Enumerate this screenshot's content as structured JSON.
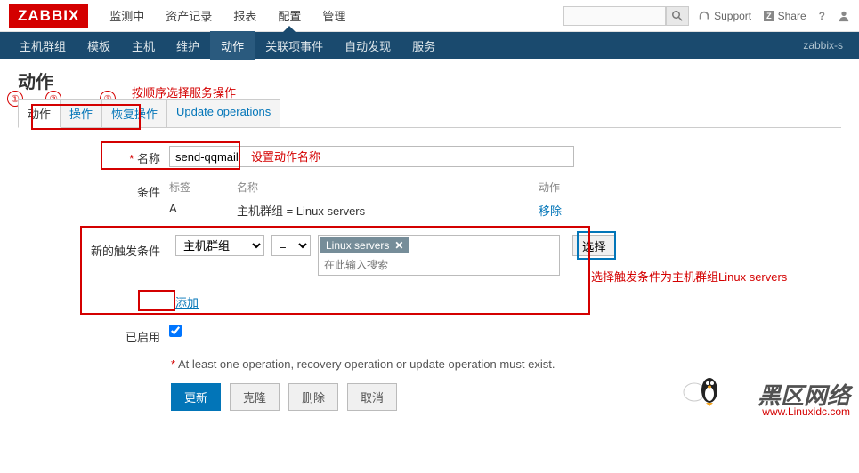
{
  "logo": "ZABBIX",
  "main_nav": [
    "监测中",
    "资产记录",
    "报表",
    "配置",
    "管理"
  ],
  "main_nav_active": 3,
  "header_links": {
    "support": "Support",
    "share": "Share"
  },
  "sub_nav": [
    "主机群组",
    "模板",
    "主机",
    "维护",
    "动作",
    "关联项事件",
    "自动发现",
    "服务"
  ],
  "sub_nav_active": 4,
  "sub_nav_right": "zabbix-s",
  "page_title": "动作",
  "tabs": [
    "动作",
    "操作",
    "恢复操作",
    "Update operations"
  ],
  "tabs_active": 0,
  "form": {
    "name_label": "名称",
    "name_value": "send-qqmail",
    "conditions_label": "条件",
    "cond_headers": {
      "label": "标签",
      "name": "名称",
      "action": "动作"
    },
    "cond_rows": [
      {
        "label": "A",
        "name": "主机群组 = Linux servers",
        "action": "移除"
      }
    ],
    "new_cond_label": "新的触发条件",
    "new_cond_type": "主机群组",
    "new_cond_op": "=",
    "new_cond_tag": "Linux servers",
    "new_cond_placeholder": "在此输入搜索",
    "select_btn": "选择",
    "add_link": "添加",
    "enabled_label": "已启用",
    "enabled_checked": true
  },
  "note": "At least one operation, recovery operation or update operation must exist.",
  "buttons": {
    "update": "更新",
    "clone": "克隆",
    "delete": "删除",
    "cancel": "取消"
  },
  "annotations": {
    "circles": [
      "①",
      "②",
      "③"
    ],
    "order_hint": "按顺序选择服务操作",
    "name_hint": "设置动作名称",
    "cond_hint": "选择触发条件为主机群组Linux servers"
  },
  "watermark": {
    "text": "黑区网络",
    "url": "www.Linuxidc.com"
  }
}
